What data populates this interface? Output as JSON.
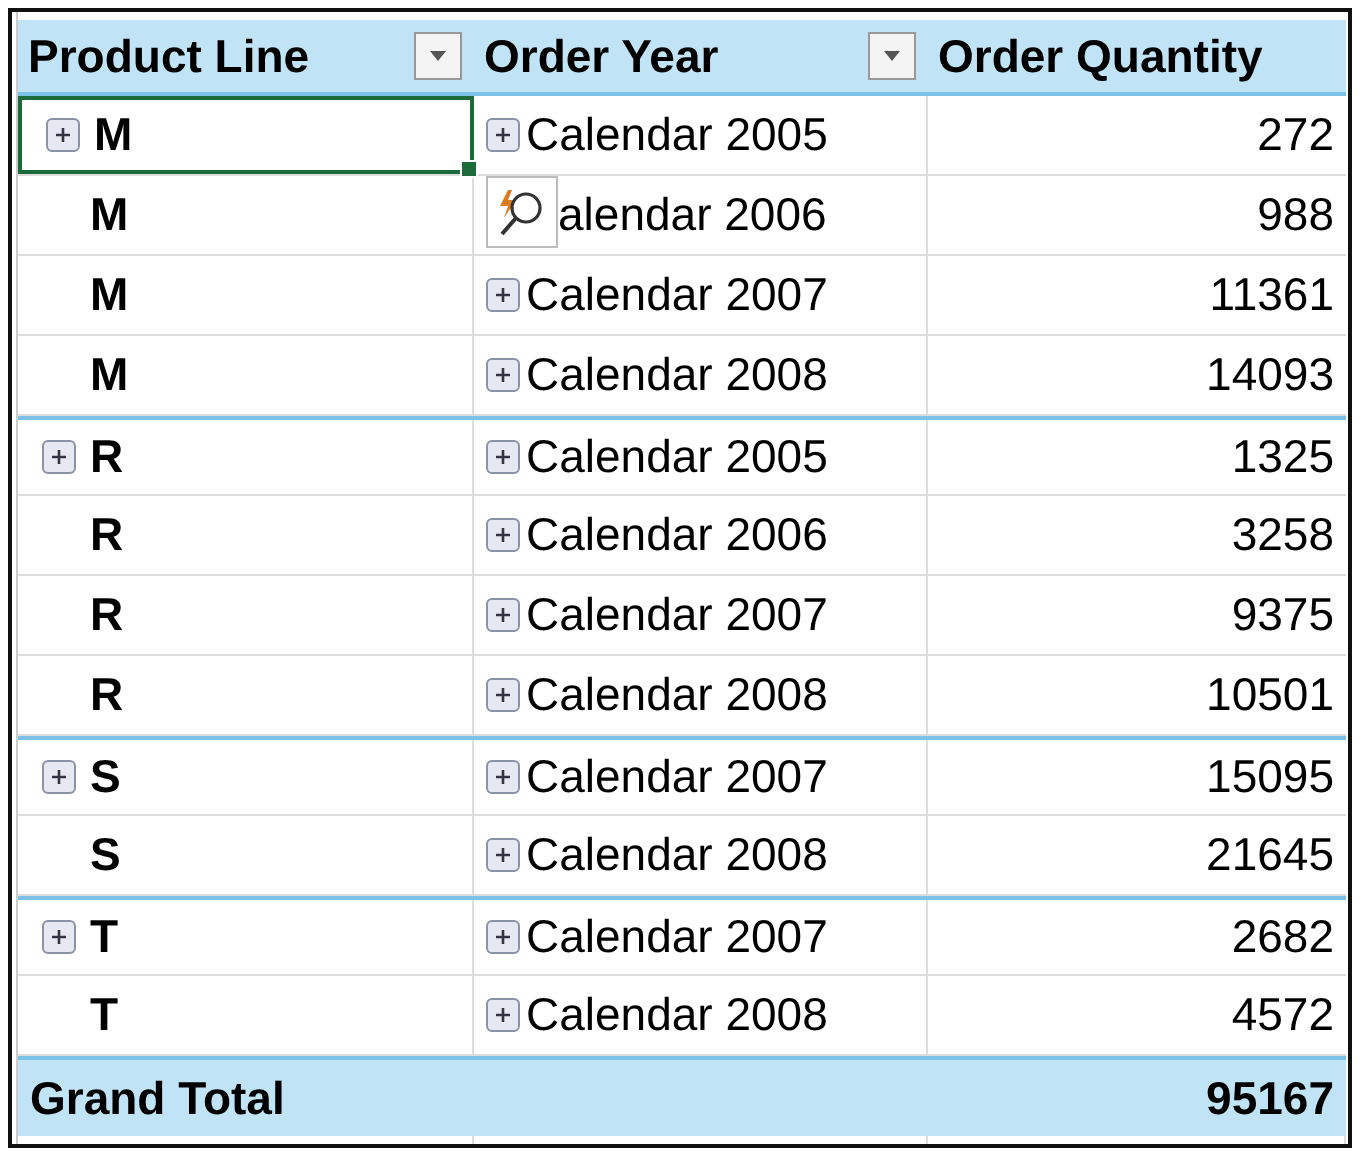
{
  "columns": [
    {
      "label": "Product Line",
      "filter": true
    },
    {
      "label": "Order Year",
      "filter": true
    },
    {
      "label": "Order Quantity",
      "filter": false
    }
  ],
  "rows": [
    {
      "product": "M",
      "expandable": true,
      "selected": true,
      "year": "Calendar 2005",
      "quantity": "272"
    },
    {
      "product": "M",
      "expandable": false,
      "selected": false,
      "year": "alendar 2006",
      "quantity": "988"
    },
    {
      "product": "M",
      "expandable": false,
      "selected": false,
      "year": "Calendar 2007",
      "quantity": "11361"
    },
    {
      "product": "M",
      "expandable": false,
      "selected": false,
      "year": "Calendar 2008",
      "quantity": "14093"
    },
    {
      "product": "R",
      "expandable": true,
      "selected": false,
      "year": "Calendar 2005",
      "quantity": "1325"
    },
    {
      "product": "R",
      "expandable": false,
      "selected": false,
      "year": "Calendar 2006",
      "quantity": "3258"
    },
    {
      "product": "R",
      "expandable": false,
      "selected": false,
      "year": "Calendar 2007",
      "quantity": "9375"
    },
    {
      "product": "R",
      "expandable": false,
      "selected": false,
      "year": "Calendar 2008",
      "quantity": "10501"
    },
    {
      "product": "S",
      "expandable": true,
      "selected": false,
      "year": "Calendar 2007",
      "quantity": "15095"
    },
    {
      "product": "S",
      "expandable": false,
      "selected": false,
      "year": "Calendar 2008",
      "quantity": "21645"
    },
    {
      "product": "T",
      "expandable": true,
      "selected": false,
      "year": "Calendar 2007",
      "quantity": "2682"
    },
    {
      "product": "T",
      "expandable": false,
      "selected": false,
      "year": "Calendar 2008",
      "quantity": "4572"
    }
  ],
  "total": {
    "label": "Grand Total",
    "quantity": "95167"
  }
}
